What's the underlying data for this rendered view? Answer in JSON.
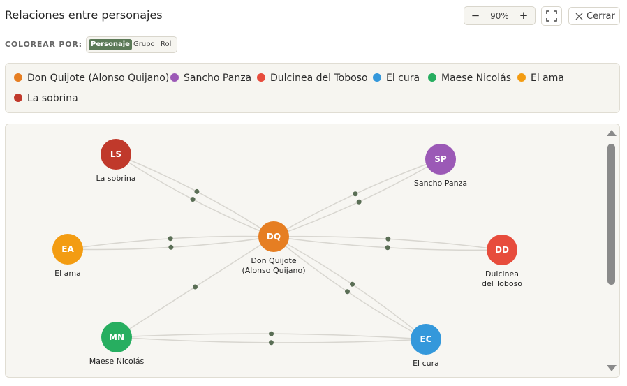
{
  "header": {
    "title": "Relaciones entre personajes",
    "zoom_minus": "−",
    "zoom_value": "90%",
    "zoom_plus": "+",
    "close_label": "Cerrar"
  },
  "color_by": {
    "label": "COLOREAR POR:",
    "options": [
      "Personaje",
      "Grupo",
      "Rol"
    ],
    "selected": "Personaje"
  },
  "legend": [
    {
      "label": "Don Quijote (Alonso Quijano)",
      "color": "#e67e22"
    },
    {
      "label": "Sancho Panza",
      "color": "#9b59b6"
    },
    {
      "label": "Dulcinea del Toboso",
      "color": "#e74c3c"
    },
    {
      "label": "El cura",
      "color": "#3498db"
    },
    {
      "label": "Maese Nicolás",
      "color": "#27ae60"
    },
    {
      "label": "El ama",
      "color": "#f39c12"
    },
    {
      "label": "La sobrina",
      "color": "#c0392b"
    }
  ],
  "nodes": [
    {
      "id": "DQ",
      "abbr": "DQ",
      "name_lines": [
        "Don Quijote",
        "(Alonso Quijano)"
      ],
      "color": "#e67e22"
    },
    {
      "id": "SP",
      "abbr": "SP",
      "name_lines": [
        "Sancho Panza"
      ],
      "color": "#9b59b6"
    },
    {
      "id": "DD",
      "abbr": "DD",
      "name_lines": [
        "Dulcinea",
        "del Toboso"
      ],
      "color": "#e74c3c"
    },
    {
      "id": "EC",
      "abbr": "EC",
      "name_lines": [
        "El cura"
      ],
      "color": "#3498db"
    },
    {
      "id": "MN",
      "abbr": "MN",
      "name_lines": [
        "Maese Nicolás"
      ],
      "color": "#27ae60"
    },
    {
      "id": "EA",
      "abbr": "EA",
      "name_lines": [
        "El ama"
      ],
      "color": "#f39c12"
    },
    {
      "id": "LS",
      "abbr": "LS",
      "name_lines": [
        "La sobrina"
      ],
      "color": "#c0392b"
    }
  ],
  "edges": [
    {
      "from": "LS",
      "to": "DQ",
      "count": 2
    },
    {
      "from": "SP",
      "to": "DQ",
      "count": 2
    },
    {
      "from": "EA",
      "to": "DQ",
      "count": 2
    },
    {
      "from": "DQ",
      "to": "DD",
      "count": 2
    },
    {
      "from": "DQ",
      "to": "EC",
      "count": 2
    },
    {
      "from": "MN",
      "to": "DQ",
      "count": 1
    },
    {
      "from": "MN",
      "to": "EC",
      "count": 2
    }
  ],
  "edge_color": "#d8d6d0",
  "edge_dot_color": "#5a6e55"
}
